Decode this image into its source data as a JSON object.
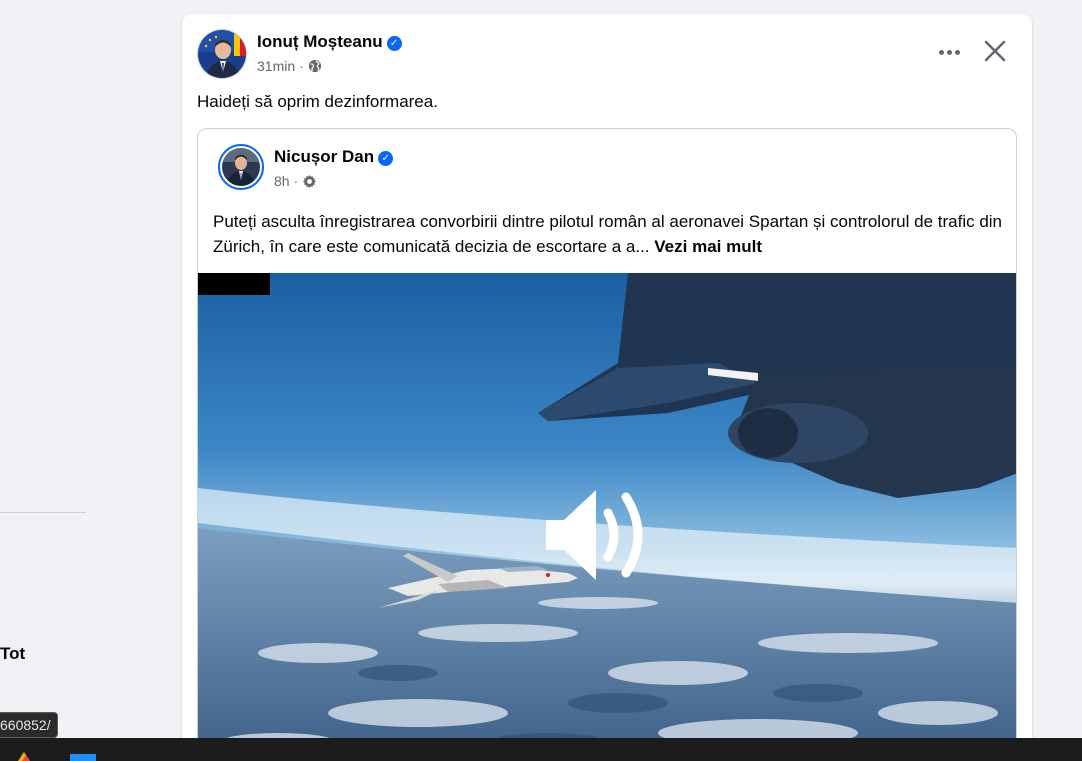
{
  "sidebar": {
    "partial_label": "Tot",
    "url_tooltip": "660852/"
  },
  "post": {
    "author": "Ionuț Moșteanu",
    "verified": true,
    "time": "31min",
    "privacy_icon": "globe-icon",
    "text": "Haideți să oprim dezinformarea.",
    "more_icon": "more-icon",
    "close_icon": "close-icon"
  },
  "shared_post": {
    "author": "Nicușor Dan",
    "verified": true,
    "time": "8h",
    "privacy_icon": "gear-icon",
    "text": "Puteți asculta înregistrarea convorbirii dintre pilotul român al aeronavei Spartan și controlorul de trafic din Zürich, în care este comunicată decizia de escortare a a...",
    "see_more": "Vezi mai mult",
    "media_icon": "speaker-icon"
  },
  "colors": {
    "accent": "#0866ff",
    "background": "#f0f2f5",
    "card": "#ffffff",
    "secondary_text": "#65676b",
    "taskbar": "#1c1c1c"
  }
}
